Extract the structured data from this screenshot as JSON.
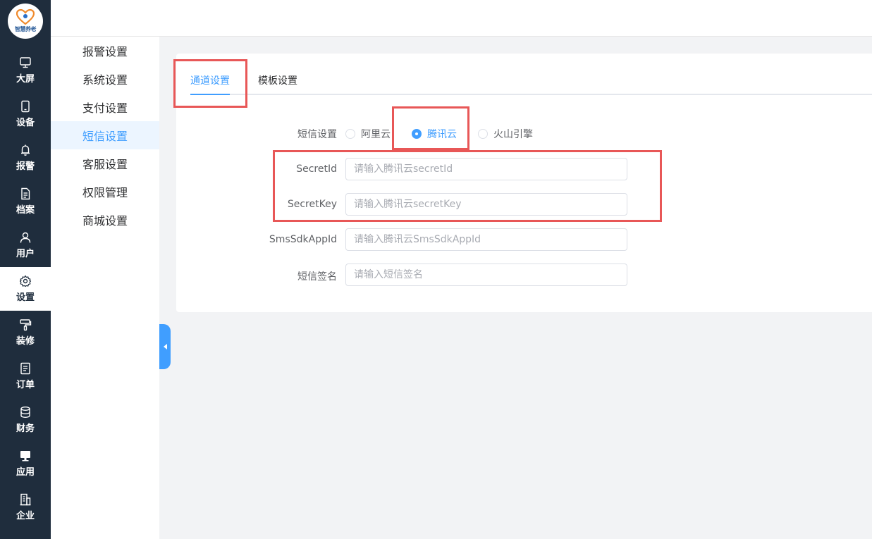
{
  "app": {
    "logo_text": "智慧养老"
  },
  "rail": {
    "items": [
      {
        "label": "大屏",
        "icon": "monitor-icon"
      },
      {
        "label": "设备",
        "icon": "tablet-icon"
      },
      {
        "label": "报警",
        "icon": "bell-icon"
      },
      {
        "label": "档案",
        "icon": "document-icon"
      },
      {
        "label": "用户",
        "icon": "user-icon"
      },
      {
        "label": "设置",
        "icon": "gear-icon",
        "active": true
      },
      {
        "label": "装修",
        "icon": "paint-roller-icon"
      },
      {
        "label": "订单",
        "icon": "order-list-icon"
      },
      {
        "label": "财务",
        "icon": "database-icon"
      },
      {
        "label": "应用",
        "icon": "desktop-icon"
      },
      {
        "label": "企业",
        "icon": "building-icon"
      }
    ]
  },
  "submenu": {
    "items": [
      "报警设置",
      "系统设置",
      "支付设置",
      "短信设置",
      "客服设置",
      "权限管理",
      "商城设置"
    ],
    "active": "短信设置"
  },
  "tabs": [
    {
      "label": "通道设置",
      "active": true
    },
    {
      "label": "模板设置",
      "active": false
    }
  ],
  "form": {
    "provider_label": "短信设置",
    "providers": [
      "阿里云",
      "腾讯云",
      "火山引擎"
    ],
    "selected_provider": "腾讯云",
    "fields": [
      {
        "label": "SecretId",
        "value": "",
        "placeholder": "请输入腾讯云secretId"
      },
      {
        "label": "SecretKey",
        "value": "",
        "placeholder": "请输入腾讯云secretKey"
      },
      {
        "label": "SmsSdkAppId",
        "value": "",
        "placeholder": "请输入腾讯云SmsSdkAppId"
      },
      {
        "label": "短信签名",
        "value": "",
        "placeholder": "请输入短信签名"
      }
    ]
  },
  "colors": {
    "accent": "#409eff",
    "rail_bg": "#1f2d3d",
    "annotation": "#e85757"
  }
}
